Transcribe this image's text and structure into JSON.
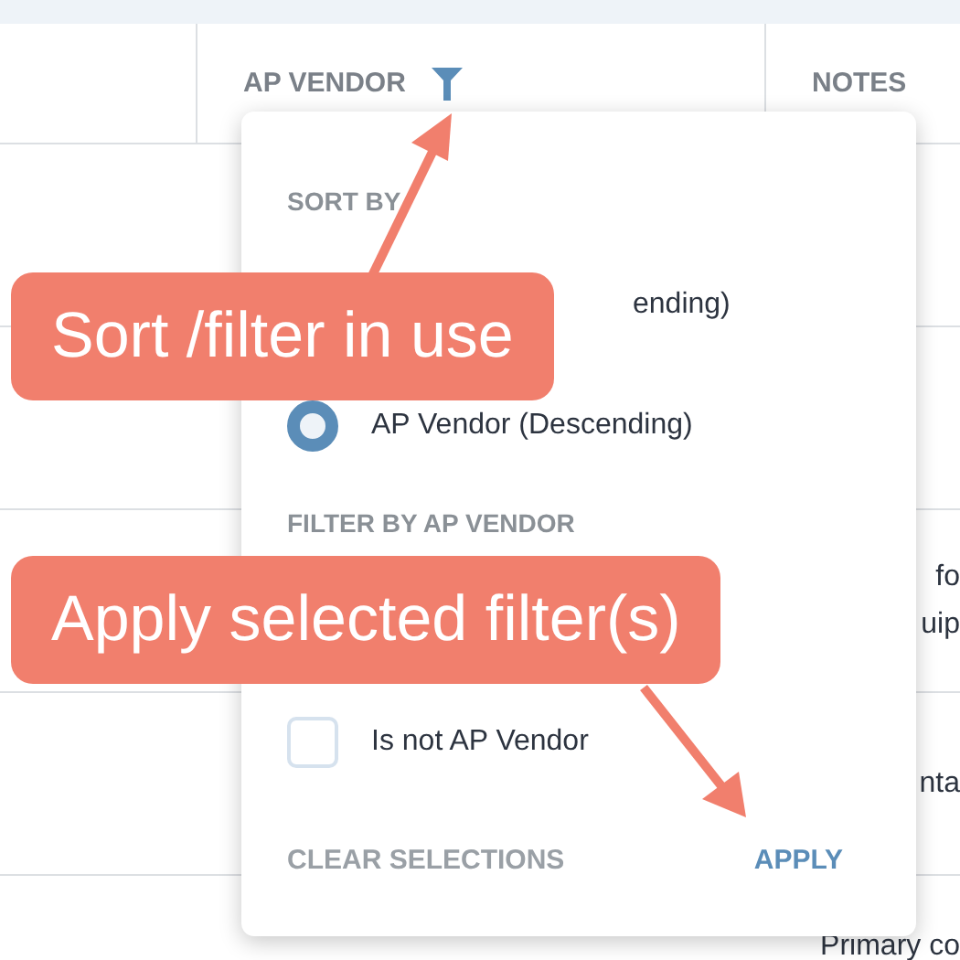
{
  "table": {
    "columns": [
      {
        "label": "AP VENDOR",
        "filtered": true
      },
      {
        "label": "NOTES",
        "filtered": false
      }
    ],
    "rows": [
      {
        "notes": [
          "fo",
          "uip"
        ]
      },
      {
        "notes": [
          "nta"
        ]
      },
      {
        "notes": [
          "Primary co"
        ]
      }
    ]
  },
  "popup": {
    "sort_heading": "SORT BY",
    "sort_options": [
      {
        "label": "ending)"
      },
      {
        "label": "AP Vendor (Descending)",
        "selected": true
      }
    ],
    "filter_heading": "FILTER BY AP VENDOR",
    "filter_options": [
      {
        "label": "Is not AP Vendor",
        "checked": false
      }
    ],
    "clear_button": "CLEAR SELECTIONS",
    "apply_button": "APPLY"
  },
  "callouts": [
    {
      "text": "Sort /filter in use"
    },
    {
      "text": "Apply selected filter(s)"
    }
  ]
}
